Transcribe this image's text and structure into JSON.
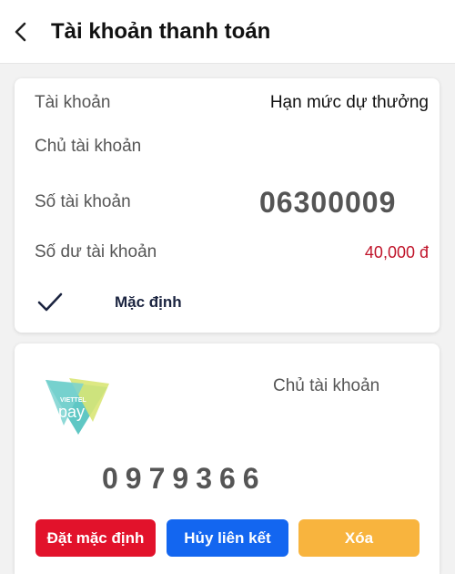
{
  "header": {
    "title": "Tài khoản thanh toán"
  },
  "card1": {
    "account_label": "Tài khoản",
    "account_name": "Hạn mức dự thưởng",
    "owner_label": "Chủ tài khoản",
    "number_label": "Số tài khoản",
    "number_value": "06300009",
    "balance_label": "Số dư tài khoản",
    "balance_value": "40,000 đ",
    "default_label": "Mặc định"
  },
  "card2": {
    "logo_text_top": "VIETTEL",
    "logo_text_main": "pay",
    "owner_label": "Chủ tài khoản",
    "phone": "0979366",
    "buttons": {
      "set_default": "Đặt mặc định",
      "unlink": "Hủy liên kết",
      "delete": "Xóa"
    }
  },
  "colors": {
    "accent_red": "#e2122b",
    "accent_blue": "#1366f0",
    "accent_orange": "#f8b43e",
    "balance_red": "#c0142a"
  }
}
